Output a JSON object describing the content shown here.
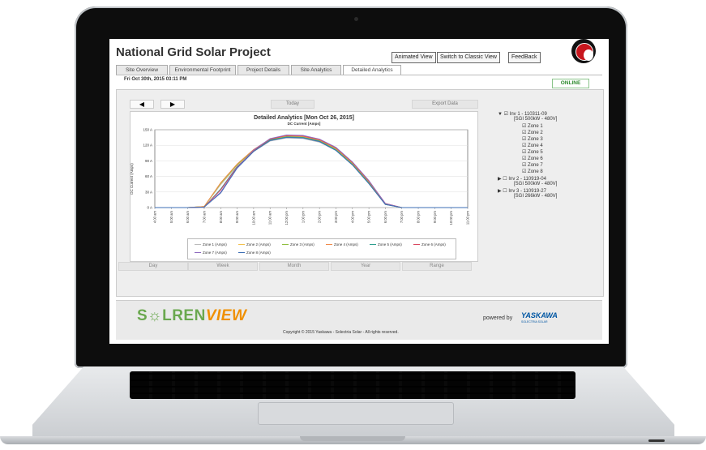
{
  "app": {
    "title": "National Grid Solar Project",
    "buttons": [
      "Animated View",
      "Switch to Classic View",
      "FeedBack"
    ]
  },
  "tabs": [
    "Site Overview",
    "Environmental Footprint",
    "Project Details",
    "Site Analytics",
    "Detailed Analytics"
  ],
  "active_tab": "Detailed Analytics",
  "status": {
    "datetime": "Fri Oct 30th, 2015 03:11 PM",
    "connection": "ONLINE"
  },
  "controls": {
    "prev": "◀",
    "next": "▶",
    "today": "Today",
    "export": "Export Data",
    "ranges": [
      "Day",
      "Week",
      "Month",
      "Year",
      "Range"
    ]
  },
  "tree": {
    "inverters": [
      {
        "name": "Inv 1 - 110311-09",
        "spec": "[SGI 500kW - 480V]",
        "checked": true,
        "expanded": true,
        "zones": [
          "Zone 1",
          "Zone 2",
          "Zone 3",
          "Zone 4",
          "Zone 5",
          "Zone 6",
          "Zone 7",
          "Zone 8"
        ]
      },
      {
        "name": "Inv 2 - 110919-04",
        "spec": "[SGI 500kW - 480V]",
        "checked": false,
        "expanded": false
      },
      {
        "name": "Inv 3 - 110919-27",
        "spec": "[SGI 266kW - 480V]",
        "checked": false,
        "expanded": false
      }
    ]
  },
  "chart_data": {
    "type": "line",
    "title": "Detailed Analytics [Mon Oct 26, 2015]",
    "subtitle": "DC Current [Amps]",
    "ylabel": "DC Current (Amps)",
    "xlabel": "",
    "ylim": [
      0,
      150
    ],
    "yticks": [
      "0 A",
      "30 A",
      "60 A",
      "90 A",
      "120 A",
      "150 A"
    ],
    "ytick_values": [
      0,
      30,
      60,
      90,
      120,
      150
    ],
    "x": [
      "4:00 am",
      "5:00 am",
      "6:00 am",
      "7:00 am",
      "8:00 am",
      "9:00 am",
      "10:00 am",
      "11:00 am",
      "12:00 pm",
      "1:00 pm",
      "2:00 pm",
      "3:00 pm",
      "4:00 pm",
      "5:00 pm",
      "6:00 pm",
      "7:00 pm",
      "8:00 pm",
      "9:00 pm",
      "10:00 pm",
      "11:00 pm"
    ],
    "grid": true,
    "legend_position": "bottom",
    "series": [
      {
        "name": "Zone 1 (Amps)",
        "color": "#bbbbbb",
        "values": [
          0,
          0,
          0,
          2,
          44,
          80,
          108,
          128,
          134,
          133,
          126,
          110,
          82,
          46,
          6,
          0,
          0,
          0,
          0,
          0
        ]
      },
      {
        "name": "Zone 2 (Amps)",
        "color": "#f2c14e",
        "values": [
          0,
          0,
          0,
          2,
          46,
          82,
          110,
          130,
          136,
          135,
          128,
          112,
          84,
          48,
          7,
          0,
          0,
          0,
          0,
          0
        ]
      },
      {
        "name": "Zone 3 (Amps)",
        "color": "#8fbf3f",
        "values": [
          0,
          0,
          0,
          2,
          47,
          83,
          111,
          131,
          137,
          136,
          129,
          113,
          85,
          49,
          7,
          0,
          0,
          0,
          0,
          0
        ]
      },
      {
        "name": "Zone 4 (Amps)",
        "color": "#f08a4b",
        "values": [
          0,
          0,
          0,
          2,
          48,
          84,
          112,
          132,
          138,
          137,
          130,
          114,
          86,
          50,
          8,
          0,
          0,
          0,
          0,
          0
        ]
      },
      {
        "name": "Zone 5 (Amps)",
        "color": "#2e9e8f",
        "values": [
          0,
          0,
          0,
          1,
          36,
          79,
          109,
          130,
          136,
          135,
          128,
          111,
          83,
          47,
          6,
          0,
          0,
          0,
          0,
          0
        ]
      },
      {
        "name": "Zone 6 (Amps)",
        "color": "#d9475f",
        "values": [
          0,
          0,
          0,
          1,
          34,
          78,
          110,
          132,
          139,
          138,
          131,
          115,
          87,
          51,
          8,
          0,
          0,
          0,
          0,
          0
        ]
      },
      {
        "name": "Zone 7 (Amps)",
        "color": "#8e6bbf",
        "values": [
          0,
          0,
          0,
          1,
          30,
          77,
          111,
          133,
          140,
          139,
          132,
          116,
          88,
          52,
          8,
          0,
          0,
          0,
          0,
          0
        ]
      },
      {
        "name": "Zone 8 (Amps)",
        "color": "#3d6fb5",
        "values": [
          0,
          0,
          0,
          1,
          28,
          76,
          108,
          129,
          135,
          134,
          127,
          110,
          82,
          46,
          6,
          0,
          0,
          0,
          0,
          0
        ]
      }
    ]
  },
  "footer": {
    "brand_a": "S☼LREN",
    "brand_b": "VIEW",
    "powered_by": "powered by",
    "partner": "YASKAWA",
    "partner_sub": "SOLECTRIA SOLAR",
    "copyright": "Copyright © 2015 Yaskawa - Solectria Solar - All rights reserved."
  },
  "colors": {
    "online": "#2e8b2e",
    "brand_green": "#6aa84f",
    "brand_orange": "#f09000",
    "partner_blue": "#0056a3"
  }
}
